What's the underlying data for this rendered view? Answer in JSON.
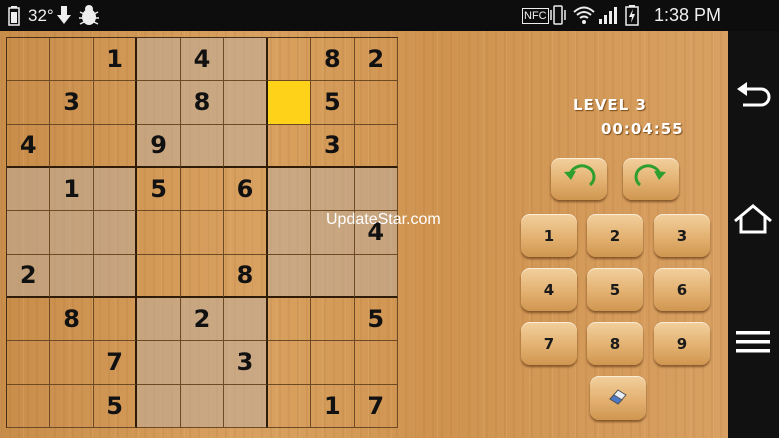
{
  "status_bar": {
    "battery_icon": "battery-icon",
    "temperature": "32°",
    "download_icon": "download-arrow-icon",
    "bug_icon": "debug-bug-icon",
    "nfc": "NFC",
    "vibrate_icon": "vibrate-icon",
    "wifi_icon": "wifi-icon",
    "signal_icon": "signal-icon",
    "battery_charging_icon": "battery-charging-icon",
    "time": "1:38 PM"
  },
  "game": {
    "level": "LEVEL 3",
    "timer": "00:04:55",
    "watermark": "UpdateStar.com",
    "selected_cell": {
      "row": 1,
      "col": 6
    },
    "board": [
      [
        "",
        "",
        "1",
        "",
        "4",
        "",
        "",
        "8",
        "2"
      ],
      [
        "",
        "3",
        "",
        "",
        "8",
        "",
        "",
        "5",
        ""
      ],
      [
        "4",
        "",
        "",
        "9",
        "",
        "",
        "",
        "3",
        ""
      ],
      [
        "",
        "1",
        "",
        "5",
        "",
        "6",
        "",
        "",
        ""
      ],
      [
        "",
        "",
        "",
        "",
        "",
        "",
        "",
        "",
        "4"
      ],
      [
        "2",
        "",
        "",
        "",
        "",
        "8",
        "",
        "",
        ""
      ],
      [
        "",
        "8",
        "",
        "",
        "2",
        "",
        "",
        "",
        "5"
      ],
      [
        "",
        "",
        "7",
        "",
        "",
        "3",
        "",
        "",
        ""
      ],
      [
        "",
        "",
        "5",
        "",
        "",
        "",
        "",
        "1",
        "7"
      ]
    ],
    "undo_icon": "undo-arrow-icon",
    "redo_icon": "redo-arrow-icon",
    "keypad": [
      "1",
      "2",
      "3",
      "4",
      "5",
      "6",
      "7",
      "8",
      "9"
    ],
    "eraser_icon": "eraser-icon",
    "colors": {
      "selected": "#ffd21a",
      "undo": "#2e9e2e",
      "redo": "#2e9e2e"
    }
  },
  "nav_bar": {
    "back_icon": "back-icon",
    "home_icon": "home-icon",
    "menu_icon": "menu-icon"
  }
}
